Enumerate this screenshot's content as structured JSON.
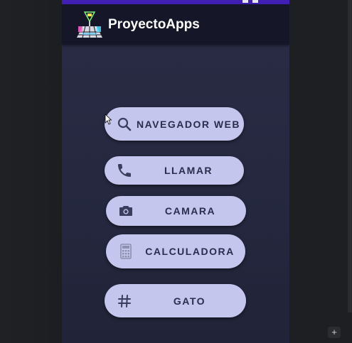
{
  "app": {
    "title": "ProyectoApps"
  },
  "buttons": [
    {
      "label": "NAVEGADOR WEB",
      "icon": "search-icon"
    },
    {
      "label": "LLAMAR",
      "icon": "phone-icon"
    },
    {
      "label": "CAMARA",
      "icon": "camera-icon"
    },
    {
      "label": "CALCULADORA",
      "icon": "calculator-icon"
    },
    {
      "label": "GATO",
      "icon": "hash-icon"
    }
  ],
  "editor": {
    "plus_label": "+"
  },
  "colors": {
    "status_bar": "#3f1fb4",
    "app_bar": "#151729",
    "screen_bg": "#25283f",
    "button_bg": "#c4c6ee",
    "button_text": "#2a2d4c"
  }
}
